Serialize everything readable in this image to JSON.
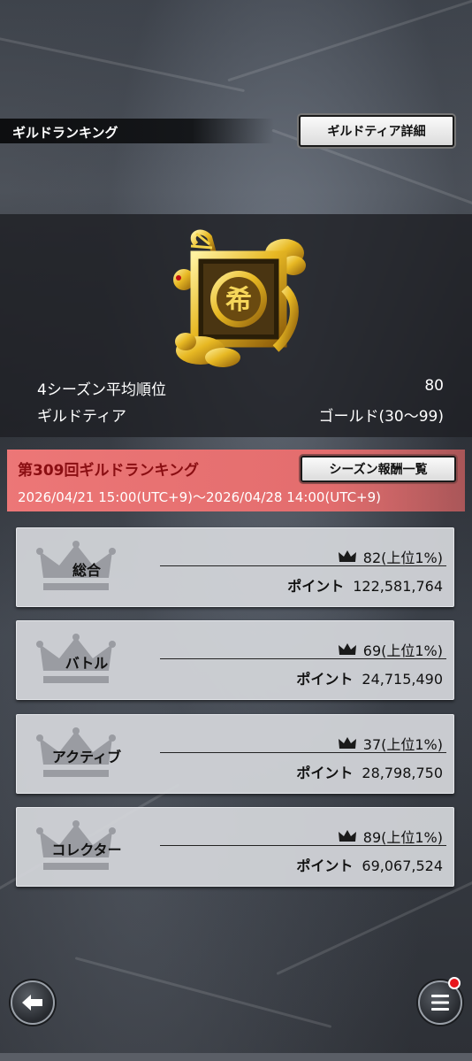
{
  "header": {
    "title": "ギルドランキング",
    "tier_detail_button": "ギルドティア詳細"
  },
  "info": {
    "avg_rank_label": "4シーズン平均順位",
    "avg_rank_value": "80",
    "tier_label": "ギルドティア",
    "tier_value": "ゴールド(30〜99)",
    "emblem_glyph": "希"
  },
  "season": {
    "title": "第309回ギルドランキング",
    "period": "2026/04/21 15:00(UTC+9)〜2026/04/28 14:00(UTC+9)",
    "rewards_button": "シーズン報酬一覧"
  },
  "categories": [
    {
      "label": "総合",
      "rank": "82(上位1%)",
      "points_label": "ポイント",
      "points": "122,581,764"
    },
    {
      "label": "バトル",
      "rank": "69(上位1%)",
      "points_label": "ポイント",
      "points": "24,715,490"
    },
    {
      "label": "アクティブ",
      "rank": "37(上位1%)",
      "points_label": "ポイント",
      "points": "28,798,750"
    },
    {
      "label": "コレクター",
      "rank": "89(上位1%)",
      "points_label": "ポイント",
      "points": "69,067,524"
    }
  ],
  "icons": {
    "back": "back-arrow-icon",
    "menu": "hamburger-menu-icon",
    "crown": "crown-icon"
  },
  "colors": {
    "season_banner": "#ef7878",
    "season_title": "#8a0e12",
    "badge": "#e8161d",
    "emblem_gold": "#e7b823"
  }
}
